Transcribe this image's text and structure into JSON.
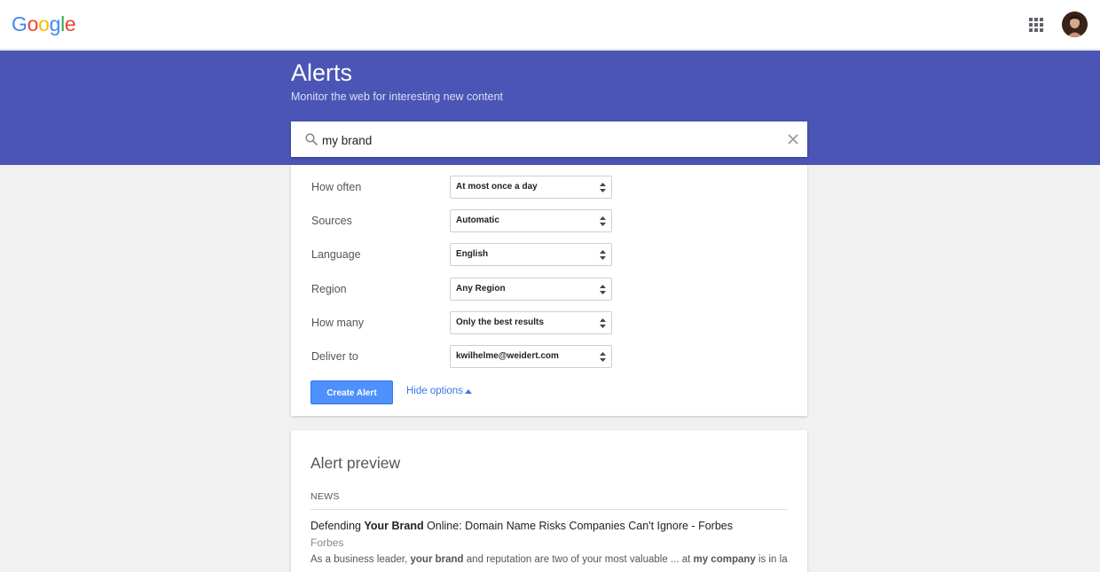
{
  "header": {
    "logo_letters": [
      "G",
      "o",
      "o",
      "g",
      "l",
      "e"
    ],
    "logo_colors": [
      "#4285f4",
      "#ea4335",
      "#fbbc05",
      "#4285f4",
      "#34a853",
      "#ea4335"
    ],
    "apps_icon": "apps-grid-icon",
    "avatar_icon": "user-avatar"
  },
  "banner": {
    "title": "Alerts",
    "subtitle": "Monitor the web for interesting new content",
    "color": "#4a55b5"
  },
  "search": {
    "value": "my brand",
    "search_icon": "search-icon",
    "clear_icon": "close-icon"
  },
  "options": [
    {
      "label": "How often",
      "value": "At most once a day"
    },
    {
      "label": "Sources",
      "value": "Automatic"
    },
    {
      "label": "Language",
      "value": "English"
    },
    {
      "label": "Region",
      "value": "Any Region"
    },
    {
      "label": "How many",
      "value": "Only the best results"
    },
    {
      "label": "Deliver to",
      "value": "kwilhelme@weidert.com"
    }
  ],
  "actions": {
    "create_label": "Create Alert",
    "create_color": "#4d90fe",
    "hide_options_label": "Hide options",
    "link_color": "#3b78e7"
  },
  "preview": {
    "title": "Alert preview",
    "section": "NEWS",
    "headline_pre": "Defending ",
    "headline_bold": "Your Brand",
    "headline_post": " Online: Domain Name Risks Companies Can't Ignore - Forbes",
    "source": "Forbes",
    "snippet_pre": "As a business leader, ",
    "snippet_bold1": "your brand",
    "snippet_mid": " and reputation are two of your most valuable ... at ",
    "snippet_bold2": "my company",
    "snippet_post": " is in large part"
  }
}
